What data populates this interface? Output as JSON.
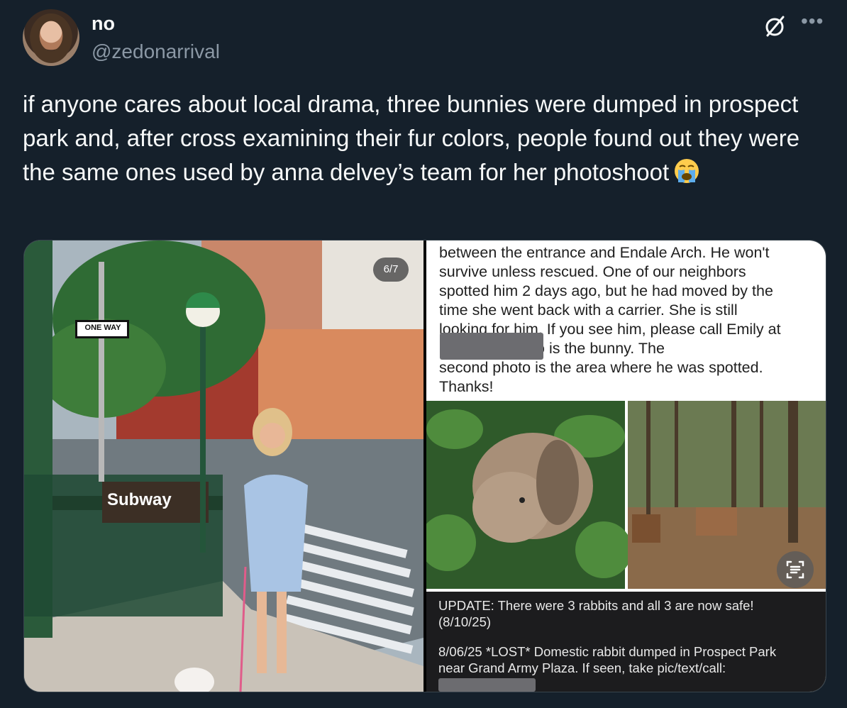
{
  "tweet": {
    "display_name": "no",
    "handle": "@zedonarrival",
    "text": "if anyone cares about local drama, three bunnies were dumped in prospect park and, after cross examining their fur colors, people found out they were the same ones used by anna delvey’s team for her photoshoot",
    "emoji": "loudly-crying-face"
  },
  "media": {
    "counter": "6/7",
    "left_photo": {
      "sign_one_way": "ONE WAY",
      "sign_subway": "Subway"
    },
    "right_photo": {
      "note_text": "between the entrance and Endale Arch. He won't\nsurvive unless rescued. One of our neighbors\nspotted him 2 days ago, but he had moved by the\ntime she went back with a carrier. She is still\nlooking for him. If you see him, please call Emily at\n                          . The first photo is the bunny. The\nsecond photo is the area where he was spotted.\nThanks!",
      "update_text": "UPDATE:  There were 3 rabbits and all 3 are now safe!\n(8/10/25)",
      "lost_text": "8/06/25 *LOST* Domestic rabbit dumped in Prospect Park\nnear Grand Army Plaza. If seen, take pic/text/call:"
    }
  },
  "colors": {
    "background": "#15202b",
    "text_primary": "#f7f9f9",
    "text_secondary": "#8b98a5",
    "border": "#38444d"
  }
}
